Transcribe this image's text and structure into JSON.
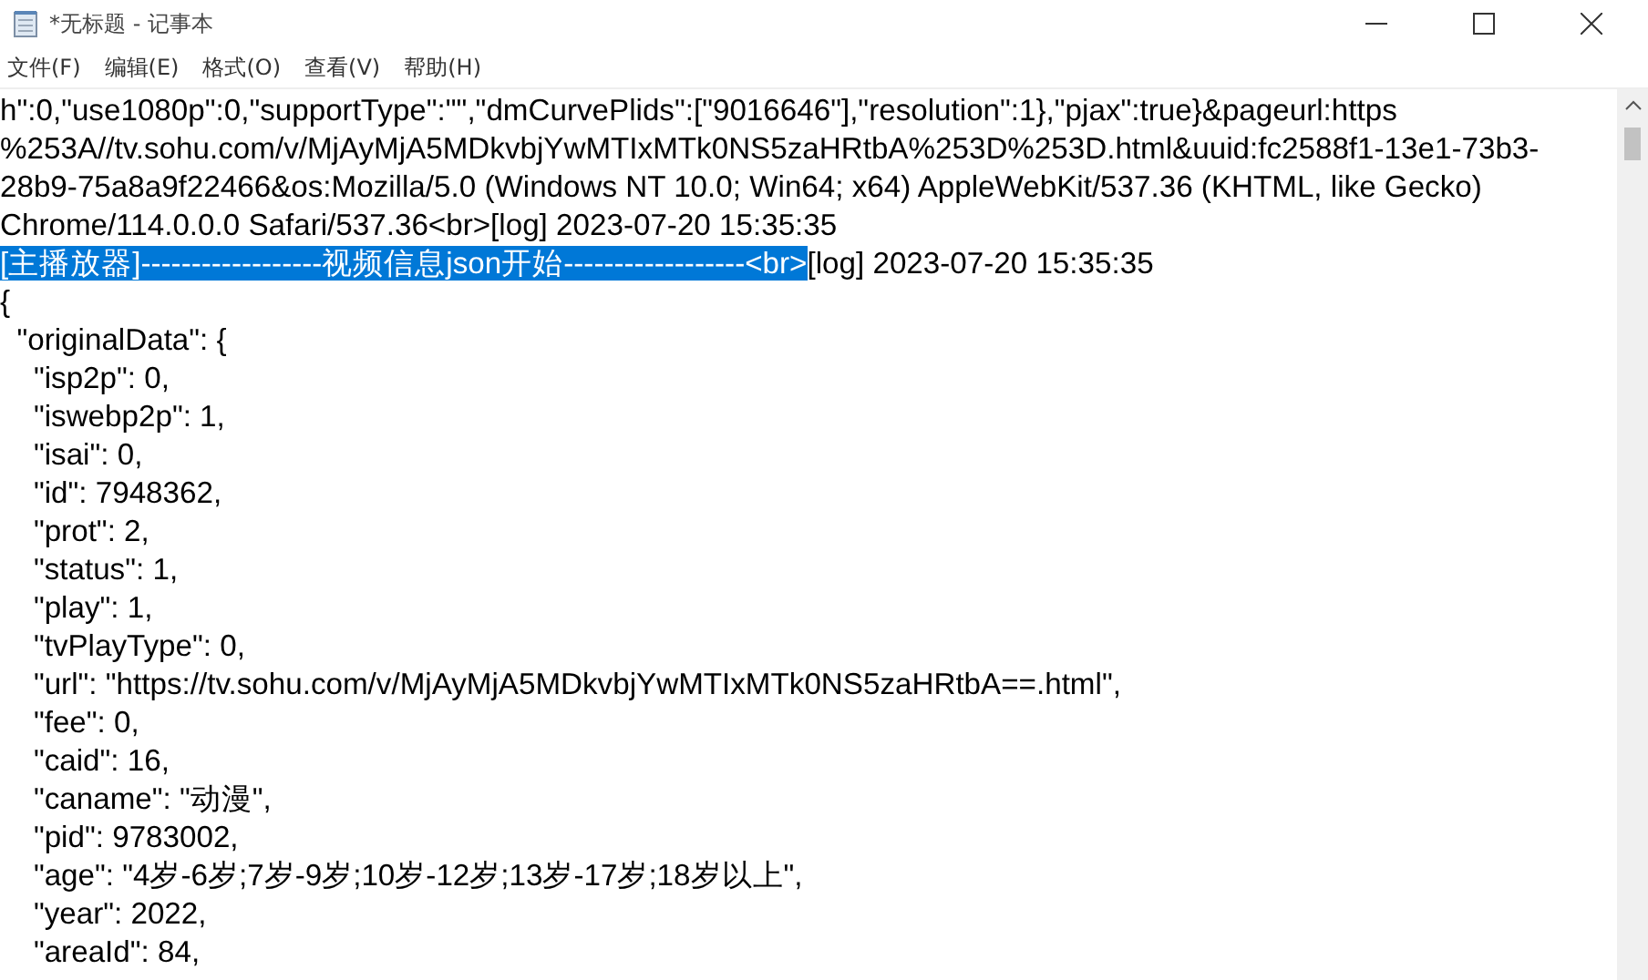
{
  "window": {
    "title": "*无标题 - 记事本"
  },
  "menu": [
    {
      "label": "文件(F)"
    },
    {
      "label": "编辑(E)"
    },
    {
      "label": "格式(O)"
    },
    {
      "label": "查看(V)"
    },
    {
      "label": "帮助(H)"
    }
  ],
  "editor": {
    "lines": [
      {
        "segments": [
          {
            "text": "h\":0,\"use1080p\":0,\"supportType\":\"\",\"dmCurvePlids\":[\"9016646\"],\"resolution\":1},\"pjax\":true}&pageurl:https",
            "selected": false
          }
        ]
      },
      {
        "segments": [
          {
            "text": "%253A//tv.sohu.com/v/MjAyMjA5MDkvbjYwMTIxMTk0NS5zaHRtbA%253D%253D.html&uuid:fc2588f1-13e1-73b3-",
            "selected": false
          }
        ]
      },
      {
        "segments": [
          {
            "text": "28b9-75a8a9f22466&os:Mozilla/5.0 (Windows NT 10.0; Win64; x64) AppleWebKit/537.36 (KHTML, like Gecko)",
            "selected": false
          }
        ]
      },
      {
        "segments": [
          {
            "text": "Chrome/114.0.0.0 Safari/537.36<br>[log] 2023-07-20 15:35:35",
            "selected": false
          }
        ]
      },
      {
        "segments": [
          {
            "text": "[主播放器]------------------视频信息json开始------------------<br>",
            "selected": true
          },
          {
            "text": "[log] 2023-07-20 15:35:35",
            "selected": false
          }
        ]
      },
      {
        "segments": [
          {
            "text": "{",
            "selected": false
          }
        ]
      },
      {
        "segments": [
          {
            "text": "  \"originalData\": {",
            "selected": false
          }
        ]
      },
      {
        "segments": [
          {
            "text": "    \"isp2p\": 0,",
            "selected": false
          }
        ]
      },
      {
        "segments": [
          {
            "text": "    \"iswebp2p\": 1,",
            "selected": false
          }
        ]
      },
      {
        "segments": [
          {
            "text": "    \"isai\": 0,",
            "selected": false
          }
        ]
      },
      {
        "segments": [
          {
            "text": "    \"id\": 7948362,",
            "selected": false
          }
        ]
      },
      {
        "segments": [
          {
            "text": "    \"prot\": 2,",
            "selected": false
          }
        ]
      },
      {
        "segments": [
          {
            "text": "    \"status\": 1,",
            "selected": false
          }
        ]
      },
      {
        "segments": [
          {
            "text": "    \"play\": 1,",
            "selected": false
          }
        ]
      },
      {
        "segments": [
          {
            "text": "    \"tvPlayType\": 0,",
            "selected": false
          }
        ]
      },
      {
        "segments": [
          {
            "text": "    \"url\": \"https://tv.sohu.com/v/MjAyMjA5MDkvbjYwMTIxMTk0NS5zaHRtbA==.html\",",
            "selected": false
          }
        ]
      },
      {
        "segments": [
          {
            "text": "    \"fee\": 0,",
            "selected": false
          }
        ]
      },
      {
        "segments": [
          {
            "text": "    \"caid\": 16,",
            "selected": false
          }
        ]
      },
      {
        "segments": [
          {
            "text": "    \"caname\": \"动漫\",",
            "selected": false
          }
        ]
      },
      {
        "segments": [
          {
            "text": "    \"pid\": 9783002,",
            "selected": false
          }
        ]
      },
      {
        "segments": [
          {
            "text": "    \"age\": \"4岁-6岁;7岁-9岁;10岁-12岁;13岁-17岁;18岁以上\",",
            "selected": false
          }
        ]
      },
      {
        "segments": [
          {
            "text": "    \"year\": 2022,",
            "selected": false
          }
        ]
      },
      {
        "segments": [
          {
            "text": "    \"areaId\": 84,",
            "selected": false
          }
        ]
      }
    ]
  }
}
